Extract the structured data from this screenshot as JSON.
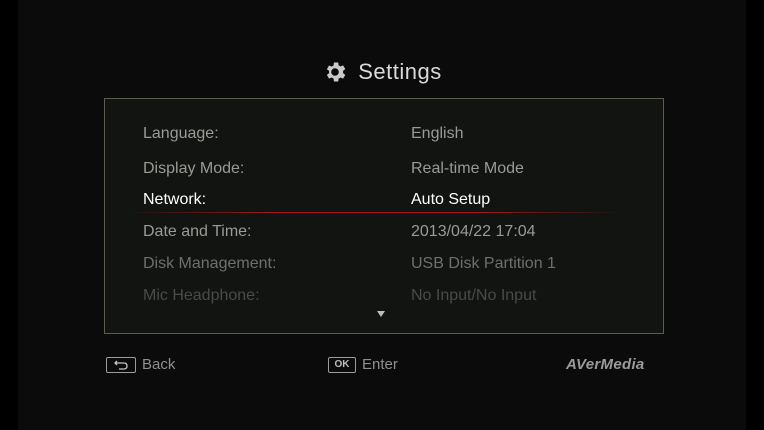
{
  "header": {
    "title": "Settings",
    "icon": "gear-icon"
  },
  "settings": {
    "rows": [
      {
        "label": "Language:",
        "value": "English"
      },
      {
        "label": "Display Mode:",
        "value": "Real-time Mode"
      },
      {
        "label": "Network:",
        "value": "Auto Setup"
      },
      {
        "label": "Date and Time:",
        "value": "2013/04/22 17:04"
      },
      {
        "label": "Disk Management:",
        "value": "USB Disk Partition 1"
      },
      {
        "label": "Mic Headphone:",
        "value": "No Input/No Input"
      }
    ],
    "selected_index": 2
  },
  "footer": {
    "back_label": "Back",
    "ok_key": "OK",
    "enter_label": "Enter",
    "brand": "AVerMedia"
  },
  "colors": {
    "selected_text": "#ffffff",
    "dim_text": "#9a9a96",
    "highlight_line": "#af1919"
  }
}
